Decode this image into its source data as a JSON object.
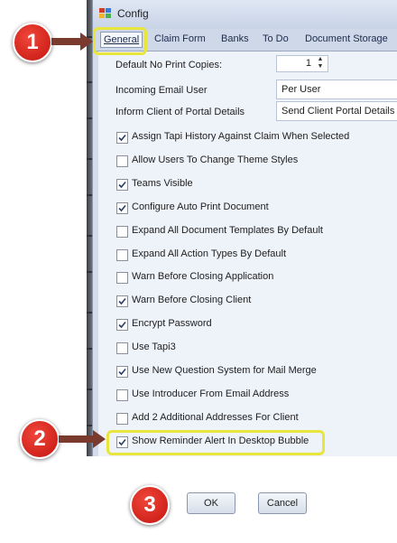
{
  "window": {
    "title": "Config"
  },
  "tabs": [
    {
      "label": "General"
    },
    {
      "label": "Claim Form"
    },
    {
      "label": "Banks"
    },
    {
      "label": "To Do"
    },
    {
      "label": "Document Storage"
    }
  ],
  "fields": {
    "default_no_print_copies": {
      "label": "Default No Print Copies:",
      "value": "1"
    },
    "incoming_email_user": {
      "label": "Incoming Email User",
      "value": "Per User"
    },
    "inform_client_portal": {
      "label": "Inform Client of Portal Details",
      "value": "Send Client Portal Details"
    }
  },
  "checkboxes": [
    {
      "label": "Assign Tapi History Against Claim When Selected",
      "checked": true
    },
    {
      "label": "Allow Users To Change Theme Styles",
      "checked": false
    },
    {
      "label": "Teams Visible",
      "checked": true
    },
    {
      "label": "Configure Auto Print Document",
      "checked": true
    },
    {
      "label": "Expand All Document Templates By Default",
      "checked": false
    },
    {
      "label": "Expand All Action Types By Default",
      "checked": false
    },
    {
      "label": "Warn Before Closing Application",
      "checked": false
    },
    {
      "label": "Warn Before Closing Client",
      "checked": true
    },
    {
      "label": "Encrypt Password",
      "checked": true
    },
    {
      "label": "Use Tapi3",
      "checked": false
    },
    {
      "label": "Use New Question System for Mail Merge",
      "checked": true
    },
    {
      "label": "Use Introducer From Email Address",
      "checked": false
    },
    {
      "label": "Add 2 Additional Addresses For Client",
      "checked": false
    },
    {
      "label": "Show Reminder Alert In Desktop Bubble",
      "checked": true
    }
  ],
  "buttons": {
    "ok": "OK",
    "cancel": "Cancel"
  },
  "callouts": [
    {
      "number": "1"
    },
    {
      "number": "2"
    },
    {
      "number": "3"
    }
  ],
  "colors": {
    "highlight": "#e8e63c",
    "marker": "#d81e16",
    "arrow": "#7a3a2e"
  }
}
